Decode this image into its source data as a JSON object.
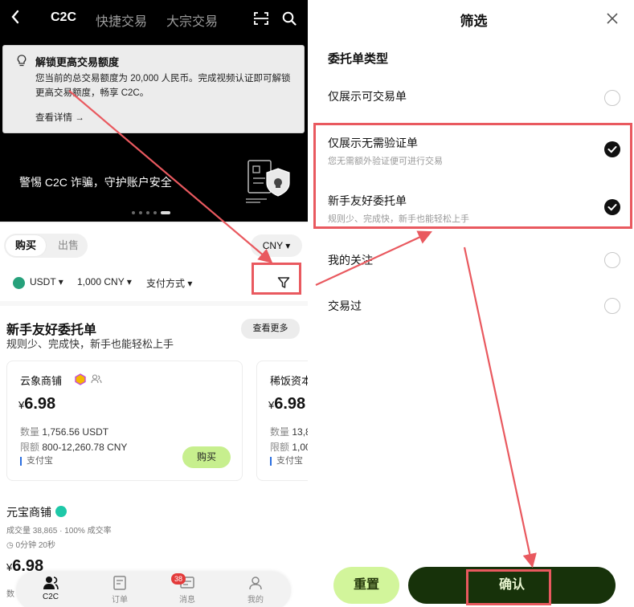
{
  "left": {
    "nav": {
      "back_icon": "chevron-left-icon",
      "tabs": [
        "C2C",
        "快捷交易",
        "大宗交易"
      ],
      "active_tab": 0
    },
    "banner": {
      "title": "解锁更高交易额度",
      "text": "您当前的总交易额度为 20,000 人民币。完成视频认证即可解锁更高交易额度，畅享 C2C。",
      "link": "查看详情 →"
    },
    "warning": "警惕 C2C 诈骗，守护账户安全",
    "segment": {
      "buy": "购买",
      "sell": "出售"
    },
    "currency": "CNY ▾",
    "filters": {
      "coin": "USDT ▾",
      "amount": "1,000 CNY ▾",
      "payment": "支付方式 ▾"
    },
    "section": {
      "title": "新手友好委托单",
      "subtitle": "规则少、完成快，新手也能轻松上手",
      "more": "查看更多"
    },
    "cards": [
      {
        "name": "云象商铺",
        "currency_symbol": "¥",
        "price": "6.98",
        "qty_label": "数量",
        "qty": "1,756.56 USDT",
        "limit_label": "限额",
        "limit": "800-12,260.78 CNY",
        "payment": "支付宝",
        "buy": "购买"
      },
      {
        "name": "稀饭资本",
        "currency_symbol": "¥",
        "price": "6.98",
        "qty_label": "数量",
        "qty": "13,8",
        "limit_label": "限额",
        "limit": "1,00",
        "payment": "支付宝"
      }
    ],
    "merchant": {
      "name": "元宝商铺",
      "stats": "成交量 38,865 · 100% 成交率",
      "time": "0分钟 20秒",
      "currency_symbol": "¥",
      "price": "6.98",
      "partial_label": "数"
    },
    "bottom_nav": [
      {
        "label": "C2C",
        "icon": "users-icon"
      },
      {
        "label": "订单",
        "icon": "orders-icon"
      },
      {
        "label": "消息",
        "icon": "message-icon",
        "badge": "38"
      },
      {
        "label": "我的",
        "icon": "profile-icon"
      }
    ]
  },
  "right": {
    "title": "筛选",
    "section_title": "委托单类型",
    "options": [
      {
        "label": "仅展示可交易单",
        "desc": "",
        "checked": false
      },
      {
        "label": "仅展示无需验证单",
        "desc": "您无需额外验证便可进行交易",
        "checked": true
      },
      {
        "label": "新手友好委托单",
        "desc": "规则少、完成快，新手也能轻松上手",
        "checked": true
      },
      {
        "label": "我的关注",
        "desc": "",
        "checked": false
      },
      {
        "label": "交易过",
        "desc": "",
        "checked": false
      }
    ],
    "reset": "重置",
    "confirm": "确认"
  },
  "colors": {
    "highlight": "#e9595f",
    "buy_green": "#c7ef8e",
    "reset_green": "#d2f59b",
    "confirm_dark": "#17320a"
  }
}
